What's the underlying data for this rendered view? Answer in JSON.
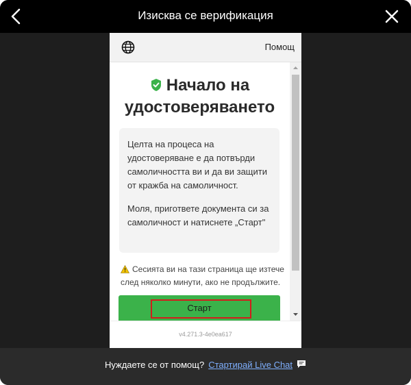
{
  "window": {
    "title": "Изисква се верификация",
    "back_icon": "chevron-left-icon",
    "close_icon": "close-icon"
  },
  "card": {
    "header": {
      "language_icon": "globe-icon",
      "help_label": "Помощ"
    },
    "heading": "Начало на удостоверяването",
    "heading_icon": "shield-check-icon",
    "info_paragraph_1": "Целта на процеса на удостоверяване е да потвърди самоличността ви и да ви защити от кражба на самоличност.",
    "info_paragraph_2": "Моля, пригответе документа си за самоличност и натиснете „Старт\"",
    "warning_icon": "warning-icon",
    "warning_text": "Сесията ви на тази страница ще изтече след няколко минути, ако не продължите.",
    "start_button_label": "Старт",
    "version": "v4.271.3-4e0ea617"
  },
  "footer": {
    "help_question": "Нуждаете се от помощ?",
    "live_chat_link": "Стартирай Live Chat",
    "chat_icon": "chat-bubble-icon"
  },
  "colors": {
    "accent_green": "#3bb24a",
    "highlight_red": "#d41c1c",
    "link_blue": "#7fb0ff"
  }
}
